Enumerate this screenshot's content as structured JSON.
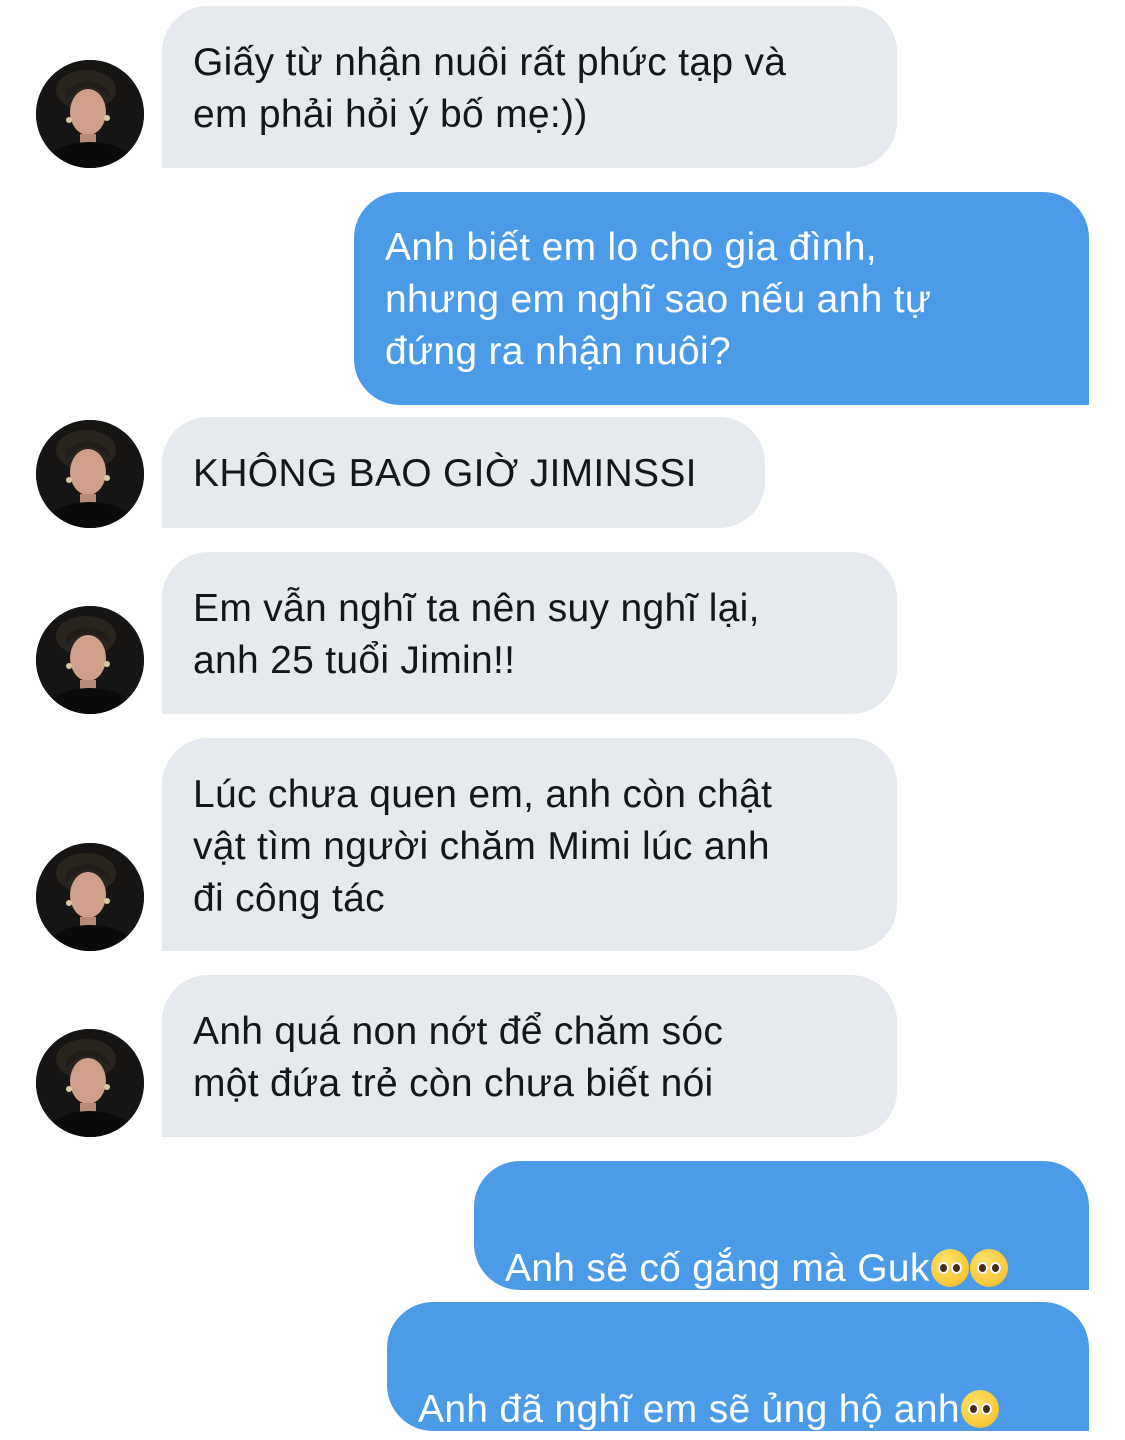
{
  "thread": {
    "messages": [
      {
        "sender": "other",
        "text": "Giấy từ nhận nuôi rất phức tạp và\nem phải hỏi ý bố mẹ:))"
      },
      {
        "sender": "self",
        "text": "Anh biết em lo cho gia đình,\nnhưng em nghĩ sao nếu anh tự\nđứng ra nhận nuôi?"
      },
      {
        "sender": "other",
        "text": "KHÔNG BAO GIỜ JIMINSSI"
      },
      {
        "sender": "other",
        "text": "Em vẫn nghĩ ta nên suy nghĩ lại,\nanh 25 tuổi Jimin!!"
      },
      {
        "sender": "other",
        "text": "Lúc chưa quen em, anh còn chật\nvật tìm người chăm Mimi lúc anh\nđi công tác"
      },
      {
        "sender": "other",
        "text": "Anh quá non nớt để chăm sóc\nmột đứa trẻ còn chưa biết nói"
      },
      {
        "sender": "self",
        "text": "Anh sẽ cố gắng mà Guk",
        "emoji": [
          "pleading-face-emoji",
          "pleading-face-emoji"
        ]
      },
      {
        "sender": "self",
        "text": "Anh đã nghĩ em sẽ ủng hộ anh",
        "emoji": [
          "pleading-face-emoji"
        ]
      }
    ]
  },
  "colors": {
    "received_bubble": "#e6e9ee",
    "received_text": "#14171a",
    "sent_bubble": "#4c9be8",
    "sent_text": "#ffffff"
  },
  "icons": {
    "avatar": "contact-avatar",
    "emoji": "pleading-face-emoji"
  }
}
